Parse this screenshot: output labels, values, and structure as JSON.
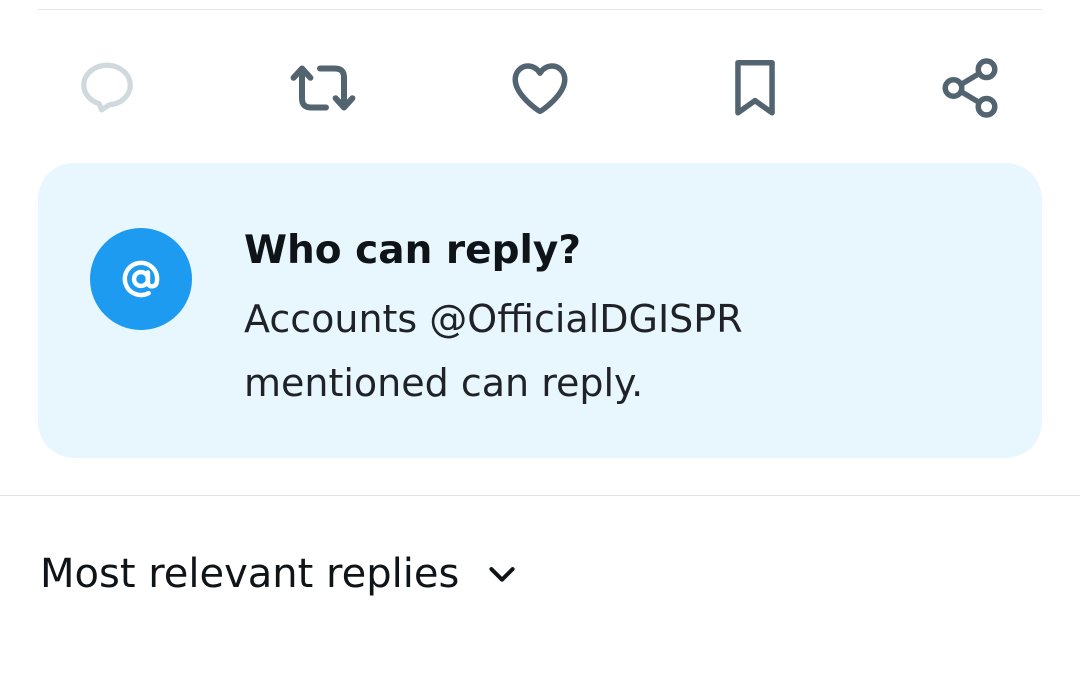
{
  "actions": [
    {
      "name": "reply-icon",
      "label": "Reply"
    },
    {
      "name": "repost-icon",
      "label": "Repost"
    },
    {
      "name": "like-icon",
      "label": "Like"
    },
    {
      "name": "bookmark-icon",
      "label": "Bookmark"
    },
    {
      "name": "share-icon",
      "label": "Share"
    }
  ],
  "reply_restriction": {
    "icon": "at-sign-icon",
    "title": "Who can reply?",
    "description": "Accounts @OfficialDGISPR mentioned can reply."
  },
  "sort": {
    "label": "Most relevant replies",
    "icon": "chevron-down-icon"
  },
  "colors": {
    "icon_gray": "#536471",
    "icon_disabled": "#cfd9de",
    "accent_blue": "#1d9bf0",
    "card_background": "#e8f6fd",
    "text_primary": "#0f1419"
  }
}
